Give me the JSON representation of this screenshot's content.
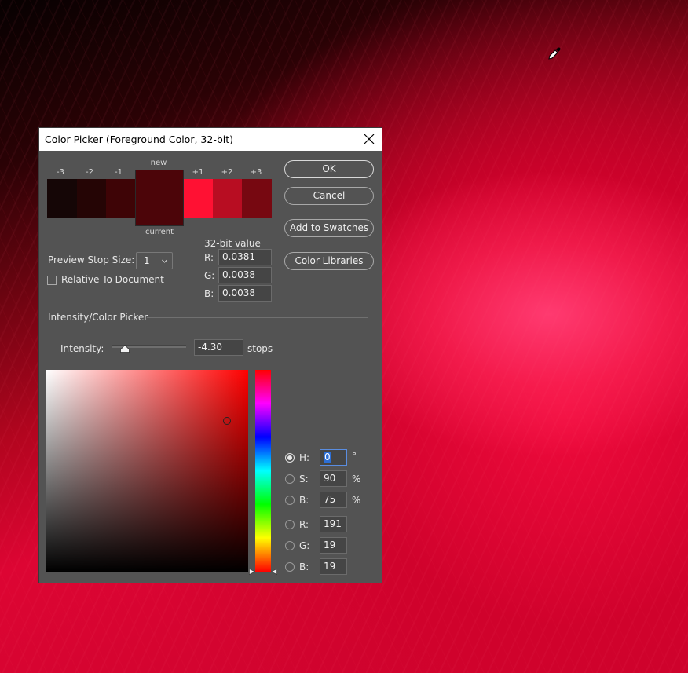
{
  "dialog": {
    "title": "Color Picker (Foreground Color, 32-bit)",
    "swatch_labels": {
      "m3": "-3",
      "m2": "-2",
      "m1": "-1",
      "new": "new",
      "current": "current",
      "p1": "+1",
      "p2": "+2",
      "p3": "+3"
    },
    "swatch_colors": {
      "m3": "#150606",
      "m2": "#250505",
      "m1": "#3e0406",
      "center": "#4c0509",
      "p1": "#ff1133",
      "p2": "#b80d22",
      "p3": "#770811"
    },
    "buttons": {
      "ok": "OK",
      "cancel": "Cancel",
      "add_to_swatches": "Add to Swatches",
      "color_libraries": "Color Libraries"
    },
    "preview_stop_size": {
      "label": "Preview Stop Size:",
      "value": "1"
    },
    "relative_to_document": {
      "label": "Relative To Document",
      "checked": false
    },
    "bit32": {
      "title": "32-bit value",
      "r_label": "R:",
      "r": "0.0381",
      "g_label": "G:",
      "g": "0.0038",
      "b_label": "B:",
      "b": "0.0038"
    },
    "section_label": "Intensity/Color Picker",
    "intensity": {
      "label": "Intensity:",
      "value": "-4.30",
      "unit": "stops"
    },
    "hsb_rgb": {
      "h_label": "H:",
      "h": "0",
      "h_unit": "°",
      "s_label": "S:",
      "s": "90",
      "s_unit": "%",
      "b_label": "B:",
      "b": "75",
      "b_unit": "%",
      "r_label": "R:",
      "r": "191",
      "g_label": "G:",
      "g": "19",
      "bl_label": "B:",
      "bl": "19",
      "selected": "H"
    }
  }
}
